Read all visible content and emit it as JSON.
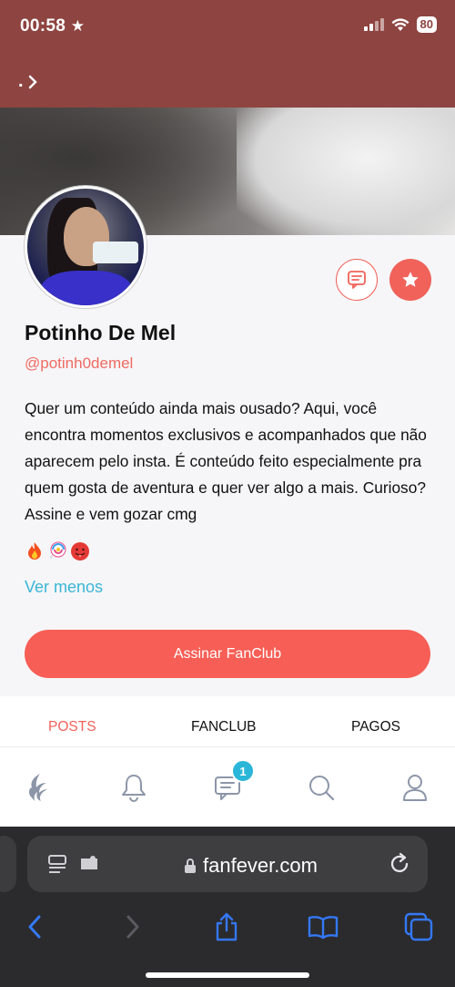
{
  "status_bar": {
    "time": "00:58",
    "battery": "80"
  },
  "topbar": {
    "back_label": "."
  },
  "profile": {
    "name": "Potinho De Mel",
    "handle": "@potinh0demel",
    "bio": "Quer um conteúdo ainda mais ousado? Aqui, você encontra momentos exclusivos e acompanhados que não aparecem pelo insta. É conteúdo feito especialmente pra quem gosta de aventura e quer ver algo a mais. Curioso? Assine e vem gozar cmg",
    "bio_emojis": [
      "fire-emoji",
      "lollipop-emoji",
      "hot-face-emoji"
    ],
    "see_less": "Ver menos",
    "subscribe_label": "Assinar FanClub"
  },
  "tabs": [
    {
      "label": "POSTS",
      "active": true
    },
    {
      "label": "FANCLUB",
      "active": false
    },
    {
      "label": "PAGOS",
      "active": false
    }
  ],
  "app_nav": {
    "items": [
      "flame-icon",
      "bell-icon",
      "chat-icon",
      "search-icon",
      "user-icon"
    ],
    "messages_badge": "1"
  },
  "browser": {
    "url": "fanfever.com"
  },
  "colors": {
    "brand": "#f0625a",
    "topbar": "#8e4440",
    "link": "#3ab6d6",
    "badge": "#2ab6d8",
    "browser_accent": "#3478f6"
  }
}
